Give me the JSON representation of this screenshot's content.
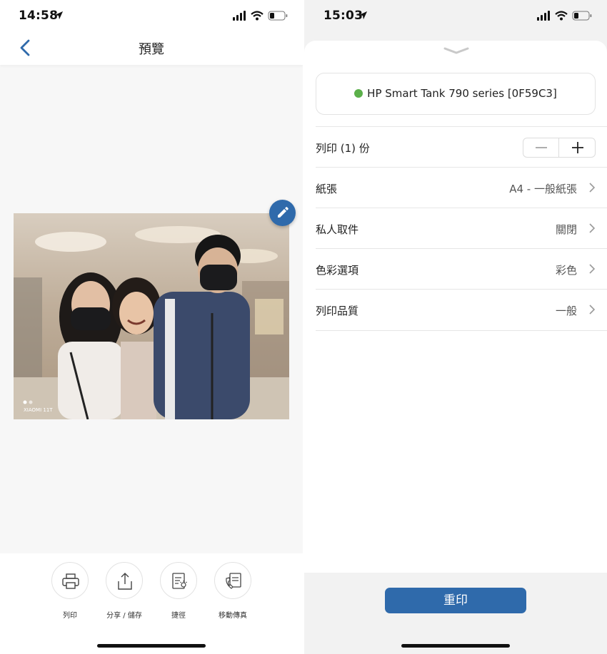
{
  "left": {
    "status": {
      "time": "14:58"
    },
    "navbar": {
      "title": "預覽",
      "back_icon": "chevron-left-icon"
    },
    "photo": {
      "watermark": "XIAOMI 11T"
    },
    "actions": [
      {
        "label": "列印",
        "icon": "printer-icon"
      },
      {
        "label": "分享 / 儲存",
        "icon": "share-icon"
      },
      {
        "label": "捷徑",
        "icon": "shortcut-icon"
      },
      {
        "label": "移動傳真",
        "icon": "mobile-fax-icon"
      }
    ]
  },
  "right": {
    "status": {
      "time": "15:03"
    },
    "printer": {
      "name": "HP Smart Tank 790 series [0F59C3]",
      "status_color": "#5bb04a"
    },
    "copies": {
      "label": "列印 (1) 份",
      "minus": "−",
      "plus": "+"
    },
    "settings": [
      {
        "label": "紙張",
        "value": "A4 - 一般紙張"
      },
      {
        "label": "私人取件",
        "value": "關閉"
      },
      {
        "label": "色彩選項",
        "value": "彩色"
      },
      {
        "label": "列印品質",
        "value": "一般"
      }
    ],
    "reprint_button": "重印"
  },
  "colors": {
    "accent": "#2f6aab",
    "online": "#5bb04a"
  }
}
